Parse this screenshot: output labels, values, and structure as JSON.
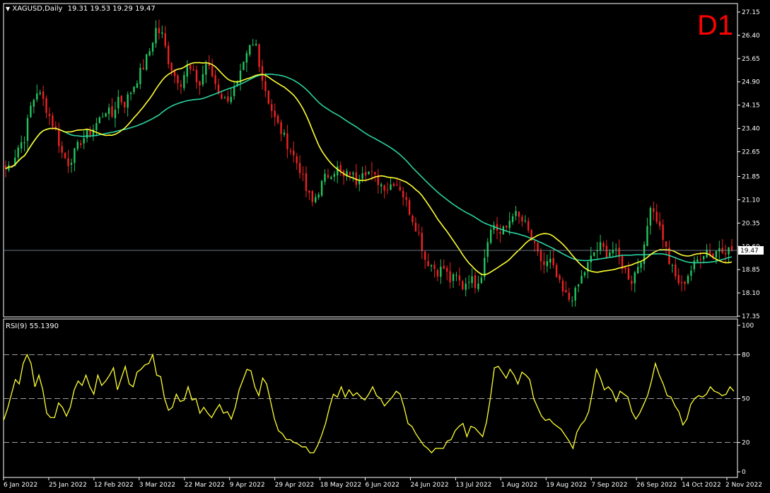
{
  "colors": {
    "background": "#000000",
    "frame": "#ffffff",
    "bull_candle": "#22c55e",
    "bear_candle": "#ef2222",
    "ma_fast": "#ffff33",
    "ma_slow": "#2ad3a0",
    "rsi_line": "#ffff33",
    "level_line": "#8a9aaa",
    "timeframe_label": "#ff0000",
    "price_tag_bg": "#ffffff",
    "price_tag_text": "#000000"
  },
  "header": {
    "symbol": "XAGUSD,Daily",
    "ohlc": "19.31 19.53 19.29 19.47",
    "timeframe": "D1"
  },
  "rsi_header": {
    "label": "RSI(9) 55.1390"
  },
  "chart_data": [
    {
      "type": "candlestick",
      "symbol": "XAGUSD",
      "timeframe": "Daily",
      "price_axis": {
        "ylim": [
          17.35,
          27.15
        ],
        "ticks": [
          "27.15",
          "26.40",
          "25.65",
          "24.90",
          "24.15",
          "23.40",
          "22.65",
          "21.85",
          "21.10",
          "20.35",
          "19.60",
          "18.85",
          "18.10",
          "17.35"
        ]
      },
      "current_price": 19.47,
      "x_axis": {
        "labels": [
          "6 Jan 2022",
          "25 Jan 2022",
          "12 Feb 2022",
          "3 Mar 2022",
          "22 Mar 2022",
          "9 Apr 2022",
          "29 Apr 2022",
          "18 May 2022",
          "6 Jun 2022",
          "24 Jun 2022",
          "13 Jul 2022",
          "1 Aug 2022",
          "19 Aug 2022",
          "7 Sep 2022",
          "26 Sep 2022",
          "14 Oct 2022",
          "2 Nov 2022"
        ]
      },
      "close_path": [
        [
          0,
          22.1
        ],
        [
          2,
          22.3
        ],
        [
          4,
          22.8
        ],
        [
          6,
          23.1
        ],
        [
          8,
          24.1
        ],
        [
          10,
          24.6
        ],
        [
          12,
          24.3
        ],
        [
          14,
          23.8
        ],
        [
          16,
          23.3
        ],
        [
          18,
          22.6
        ],
        [
          20,
          22.3
        ],
        [
          22,
          22.6
        ],
        [
          24,
          23.0
        ],
        [
          26,
          23.2
        ],
        [
          28,
          23.4
        ],
        [
          30,
          23.7
        ],
        [
          32,
          24.0
        ],
        [
          34,
          23.8
        ],
        [
          36,
          24.4
        ],
        [
          38,
          24.2
        ],
        [
          40,
          24.6
        ],
        [
          42,
          25.0
        ],
        [
          44,
          25.4
        ],
        [
          46,
          25.9
        ],
        [
          48,
          26.6
        ],
        [
          50,
          26.4
        ],
        [
          52,
          25.6
        ],
        [
          54,
          25.1
        ],
        [
          56,
          24.9
        ],
        [
          58,
          25.4
        ],
        [
          60,
          25.1
        ],
        [
          62,
          24.8
        ],
        [
          64,
          25.5
        ],
        [
          66,
          25.1
        ],
        [
          68,
          24.6
        ],
        [
          70,
          24.3
        ],
        [
          72,
          24.5
        ],
        [
          74,
          24.8
        ],
        [
          76,
          25.4
        ],
        [
          78,
          26.0
        ],
        [
          80,
          26.1
        ],
        [
          82,
          25.0
        ],
        [
          84,
          24.3
        ],
        [
          86,
          23.7
        ],
        [
          88,
          23.3
        ],
        [
          90,
          22.9
        ],
        [
          92,
          22.5
        ],
        [
          94,
          22.1
        ],
        [
          96,
          21.4
        ],
        [
          98,
          21.0
        ],
        [
          100,
          21.4
        ],
        [
          102,
          21.8
        ],
        [
          104,
          22.0
        ],
        [
          106,
          22.1
        ],
        [
          108,
          21.8
        ],
        [
          110,
          22.0
        ],
        [
          112,
          21.7
        ],
        [
          114,
          22.1
        ],
        [
          116,
          22.0
        ],
        [
          118,
          21.8
        ],
        [
          120,
          21.6
        ],
        [
          122,
          21.5
        ],
        [
          124,
          21.7
        ],
        [
          126,
          21.5
        ],
        [
          128,
          21.0
        ],
        [
          130,
          20.5
        ],
        [
          132,
          20.0
        ],
        [
          134,
          19.2
        ],
        [
          136,
          19.0
        ],
        [
          138,
          18.8
        ],
        [
          140,
          18.9
        ],
        [
          142,
          18.5
        ],
        [
          144,
          18.6
        ],
        [
          146,
          18.3
        ],
        [
          148,
          18.6
        ],
        [
          150,
          18.4
        ],
        [
          152,
          18.7
        ],
        [
          154,
          19.9
        ],
        [
          156,
          20.3
        ],
        [
          158,
          20.0
        ],
        [
          160,
          20.2
        ],
        [
          162,
          20.7
        ],
        [
          164,
          20.5
        ],
        [
          166,
          20.3
        ],
        [
          168,
          19.8
        ],
        [
          170,
          19.3
        ],
        [
          172,
          19.0
        ],
        [
          174,
          19.1
        ],
        [
          176,
          18.6
        ],
        [
          178,
          18.1
        ],
        [
          180,
          17.9
        ],
        [
          182,
          18.1
        ],
        [
          184,
          18.6
        ],
        [
          186,
          19.0
        ],
        [
          188,
          19.4
        ],
        [
          190,
          19.6
        ],
        [
          192,
          19.4
        ],
        [
          194,
          19.5
        ],
        [
          196,
          19.2
        ],
        [
          198,
          18.8
        ],
        [
          200,
          18.5
        ],
        [
          202,
          19.0
        ],
        [
          204,
          19.5
        ],
        [
          206,
          21.0
        ],
        [
          208,
          20.5
        ],
        [
          210,
          19.9
        ],
        [
          212,
          19.1
        ],
        [
          214,
          18.6
        ],
        [
          216,
          18.3
        ],
        [
          218,
          18.7
        ],
        [
          220,
          19.0
        ],
        [
          222,
          19.3
        ],
        [
          224,
          19.5
        ],
        [
          226,
          19.3
        ],
        [
          228,
          19.6
        ],
        [
          230,
          19.5
        ],
        [
          232,
          19.47
        ]
      ],
      "candle_count": 233
    },
    {
      "type": "line",
      "title": "RSI(9) 55.1390",
      "ylim": [
        0,
        100
      ],
      "ticks": [
        "100",
        "80",
        "50",
        "20",
        "0"
      ],
      "levels": [
        80,
        50,
        20
      ],
      "values": [
        35,
        43,
        53,
        63,
        60,
        74,
        80,
        74,
        58,
        66,
        56,
        40,
        37,
        37,
        47,
        44,
        38,
        44,
        56,
        62,
        59,
        66,
        58,
        53,
        66,
        59,
        62,
        66,
        71,
        56,
        64,
        72,
        60,
        58,
        68,
        70,
        73,
        74,
        80,
        66,
        65,
        50,
        42,
        44,
        53,
        48,
        49,
        58,
        49,
        50,
        40,
        44,
        40,
        37,
        42,
        46,
        40,
        41,
        36,
        44,
        56,
        63,
        70,
        69,
        58,
        52,
        64,
        60,
        48,
        36,
        28,
        26,
        22,
        22,
        20,
        19,
        17,
        17,
        13,
        13,
        18,
        25,
        33,
        44,
        53,
        51,
        58,
        51,
        56,
        52,
        54,
        51,
        49,
        53,
        58,
        52,
        50,
        45,
        48,
        51,
        55,
        53,
        44,
        33,
        31,
        26,
        22,
        18,
        16,
        13,
        16,
        16,
        16,
        21,
        22,
        28,
        31,
        33,
        24,
        31,
        30,
        27,
        24,
        34,
        51,
        71,
        72,
        68,
        64,
        70,
        66,
        60,
        68,
        66,
        63,
        50,
        44,
        38,
        35,
        36,
        33,
        31,
        29,
        25,
        21,
        16,
        27,
        32,
        35,
        41,
        55,
        70,
        64,
        56,
        58,
        55,
        48,
        55,
        53,
        51,
        41,
        36,
        40,
        46,
        52,
        62,
        74,
        66,
        60,
        52,
        51,
        45,
        41,
        32,
        36,
        46,
        50,
        52,
        51,
        53,
        58,
        55,
        54,
        52,
        53,
        58,
        55
      ],
      "current_value": 55.139
    }
  ]
}
